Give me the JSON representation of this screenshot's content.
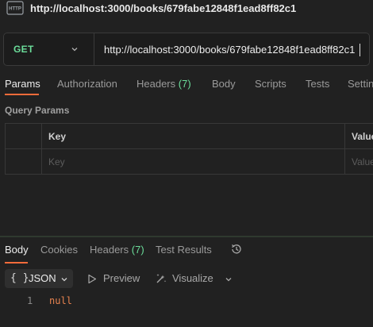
{
  "request": {
    "icon_text": "HTTP",
    "title": "http://localhost:3000/books/679fabe12848f1ead8ff82c1",
    "method": "GET",
    "url": "http://localhost:3000/books/679fabe12848f1ead8ff82c1"
  },
  "request_tabs": [
    {
      "label": "Params",
      "active": true
    },
    {
      "label": "Authorization"
    },
    {
      "label": "Headers",
      "count": "(7)"
    },
    {
      "label": "Body"
    },
    {
      "label": "Scripts"
    },
    {
      "label": "Tests"
    },
    {
      "label": "Settin"
    }
  ],
  "query_params": {
    "title": "Query Params",
    "columns": [
      "Key",
      "Value"
    ],
    "placeholders": {
      "key": "Key",
      "value": "Value"
    }
  },
  "response_tabs": [
    {
      "label": "Body",
      "active": true
    },
    {
      "label": "Cookies"
    },
    {
      "label": "Headers",
      "count": "(7)"
    },
    {
      "label": "Test Results"
    }
  ],
  "response_toolbar": {
    "format_braces": "{ }",
    "format": "JSON",
    "preview": "Preview",
    "visualize": "Visualize"
  },
  "response_body": {
    "lines": [
      {
        "number": "1",
        "text": "null"
      }
    ]
  },
  "colors": {
    "method": "#6bdd9a",
    "active_underline": "#f26b3a",
    "code_value": "#e8834f",
    "background": "#212121"
  },
  "icons": {
    "request_type": "http-file-icon",
    "history": "history-icon",
    "preview": "play-icon",
    "visualize": "wand-icon",
    "chevron": "chevron-down-icon"
  }
}
